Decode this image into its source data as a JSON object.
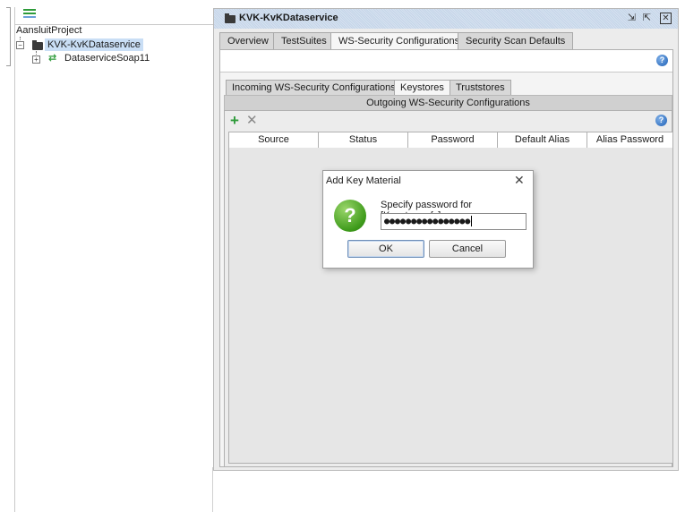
{
  "navigator": {
    "icon": "list-view-icon",
    "project_name": "AansluitProject",
    "service_name": "KVK-KvKDataservice",
    "interface_name": "DataserviceSoap11"
  },
  "editor": {
    "title": "KVK-KvKDataservice",
    "tabs": [
      "Overview",
      "TestSuites",
      "WS-Security Configurations",
      "Security Scan Defaults"
    ],
    "active_tab": "WS-Security Configurations",
    "subtabs": [
      "Incoming WS-Security Configurations",
      "Keystores",
      "Truststores"
    ],
    "active_subtab": "Keystores",
    "outgoing_label": "Outgoing WS-Security Configurations",
    "toolbar": {
      "add_icon": "plus-icon",
      "remove_icon": "x-icon"
    },
    "table": {
      "columns": [
        "Source",
        "Status",
        "Password",
        "Default Alias",
        "Alias Password"
      ]
    }
  },
  "dialog": {
    "title": "Add Key Material",
    "message": "Specify password for [Keystore.pfx]",
    "password_mask": "●●●●●●●●●●●●●●●●",
    "ok_label": "OK",
    "cancel_label": "Cancel",
    "icon": "question-icon"
  },
  "colors": {
    "selection": "#c9def5",
    "titlebar": "#c4d4e8",
    "accent_green": "#2e9b3a",
    "help_blue": "#1d5fb5"
  }
}
